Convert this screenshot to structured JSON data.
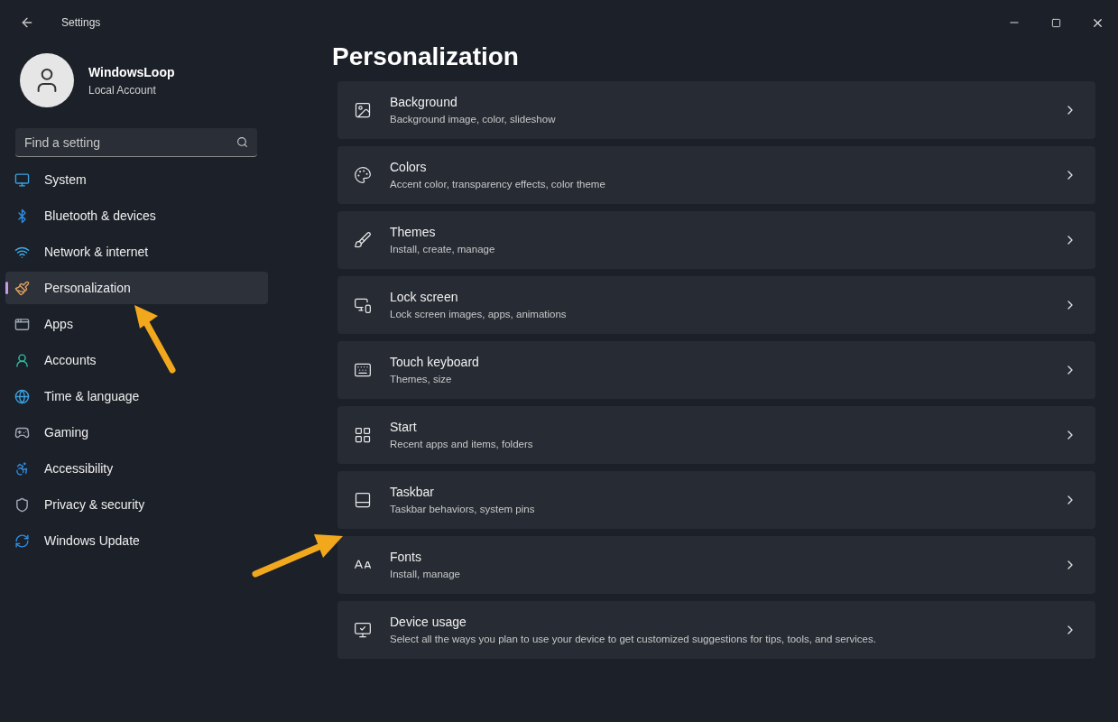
{
  "window": {
    "title": "Settings"
  },
  "user": {
    "name": "WindowsLoop",
    "account": "Local Account"
  },
  "search": {
    "placeholder": "Find a setting"
  },
  "sidebar": {
    "items": [
      {
        "label": "System",
        "selected": false
      },
      {
        "label": "Bluetooth & devices",
        "selected": false
      },
      {
        "label": "Network & internet",
        "selected": false
      },
      {
        "label": "Personalization",
        "selected": true
      },
      {
        "label": "Apps",
        "selected": false
      },
      {
        "label": "Accounts",
        "selected": false
      },
      {
        "label": "Time & language",
        "selected": false
      },
      {
        "label": "Gaming",
        "selected": false
      },
      {
        "label": "Accessibility",
        "selected": false
      },
      {
        "label": "Privacy & security",
        "selected": false
      },
      {
        "label": "Windows Update",
        "selected": false
      }
    ]
  },
  "page": {
    "title": "Personalization"
  },
  "cards": [
    {
      "title": "Background",
      "subtitle": "Background image, color, slideshow"
    },
    {
      "title": "Colors",
      "subtitle": "Accent color, transparency effects, color theme"
    },
    {
      "title": "Themes",
      "subtitle": "Install, create, manage"
    },
    {
      "title": "Lock screen",
      "subtitle": "Lock screen images, apps, animations"
    },
    {
      "title": "Touch keyboard",
      "subtitle": "Themes, size"
    },
    {
      "title": "Start",
      "subtitle": "Recent apps and items, folders"
    },
    {
      "title": "Taskbar",
      "subtitle": "Taskbar behaviors, system pins"
    },
    {
      "title": "Fonts",
      "subtitle": "Install, manage"
    },
    {
      "title": "Device usage",
      "subtitle": "Select all the ways you plan to use your device to get customized suggestions for tips, tools, and services."
    }
  ]
}
